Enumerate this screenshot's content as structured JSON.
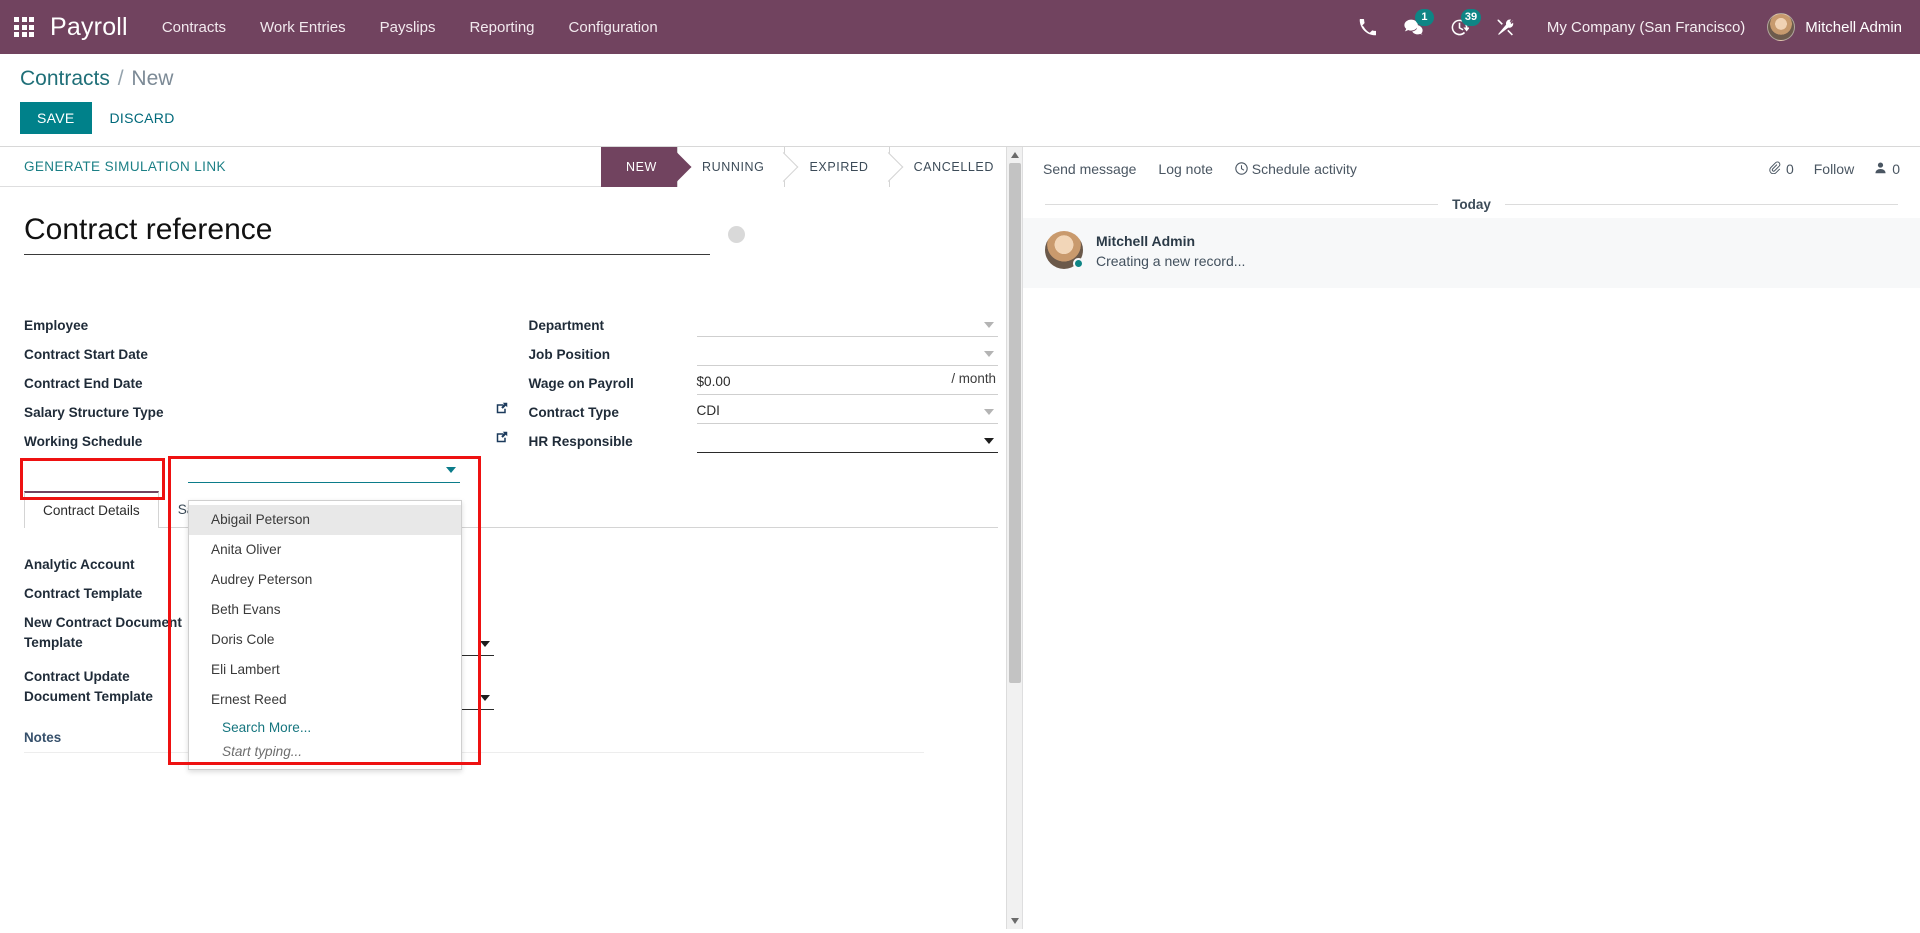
{
  "navbar": {
    "apps_icon": "apps-grid-icon",
    "brand": "Payroll",
    "menu": [
      {
        "label": "Contracts"
      },
      {
        "label": "Work Entries"
      },
      {
        "label": "Payslips"
      },
      {
        "label": "Reporting"
      },
      {
        "label": "Configuration"
      }
    ],
    "icons": [
      {
        "name": "phone-icon",
        "badge": null
      },
      {
        "name": "messages-icon",
        "badge": "1"
      },
      {
        "name": "activities-clock-icon",
        "badge": "39"
      },
      {
        "name": "debug-tools-icon",
        "badge": null
      }
    ],
    "company": "My Company (San Francisco)",
    "user": "Mitchell Admin",
    "accent_bg": "#71435f",
    "badge_color": "#0e8585"
  },
  "control_panel": {
    "breadcrumb_root": "Contracts",
    "breadcrumb_sep": "/",
    "breadcrumb_current": "New",
    "save_label": "SAVE",
    "discard_label": "DISCARD",
    "save_color": "#00818a"
  },
  "sheet_header": {
    "simulation_link": "GENERATE SIMULATION LINK",
    "statuses": [
      {
        "label": "NEW",
        "active": true
      },
      {
        "label": "RUNNING",
        "active": false
      },
      {
        "label": "EXPIRED",
        "active": false
      },
      {
        "label": "CANCELLED",
        "active": false
      }
    ]
  },
  "form": {
    "title_placeholder": "Contract reference",
    "title_value": "",
    "left_fields": [
      {
        "label": "Employee",
        "value": "",
        "widget": "many2one",
        "highlighted": true
      },
      {
        "label": "Contract Start Date",
        "value": "",
        "widget": "date"
      },
      {
        "label": "Contract End Date",
        "value": "",
        "widget": "date"
      },
      {
        "label": "Salary Structure Type",
        "value": "",
        "widget": "many2one-internal"
      },
      {
        "label": "Working Schedule",
        "value": "",
        "widget": "many2one-internal"
      }
    ],
    "right_fields": [
      {
        "label": "Department",
        "value": "",
        "widget": "many2one"
      },
      {
        "label": "Job Position",
        "value": "",
        "widget": "many2one"
      },
      {
        "label": "Wage on Payroll",
        "value": "$0.00",
        "widget": "monetary",
        "suffix": "/ month"
      },
      {
        "label": "Contract Type",
        "value": "CDI",
        "widget": "many2one-external"
      },
      {
        "label": "HR Responsible",
        "value": "",
        "widget": "many2one-focused"
      }
    ],
    "tabs": [
      {
        "label": "Contract Details",
        "active": true
      },
      {
        "label": "Salary Information",
        "active": false
      }
    ],
    "detail_fields": [
      {
        "label": "Analytic Account",
        "value": ""
      },
      {
        "label": "Contract Template",
        "value": ""
      },
      {
        "label": "New Contract Document Template",
        "value": "",
        "caret": true
      },
      {
        "label": "Contract Update Document Template",
        "value": "",
        "caret": true
      }
    ],
    "notes_label": "Notes"
  },
  "employee_dropdown": {
    "open": true,
    "input_value": "",
    "items": [
      {
        "label": "Abigail Peterson",
        "highlighted": true
      },
      {
        "label": "Anita Oliver",
        "highlighted": false
      },
      {
        "label": "Audrey Peterson",
        "highlighted": false
      },
      {
        "label": "Beth Evans",
        "highlighted": false
      },
      {
        "label": "Doris Cole",
        "highlighted": false
      },
      {
        "label": "Eli Lambert",
        "highlighted": false
      },
      {
        "label": "Ernest Reed",
        "highlighted": false
      }
    ],
    "search_more": "Search More...",
    "hint": "Start typing...",
    "link_color": "#16767f"
  },
  "chatter": {
    "send_message": "Send message",
    "log_note": "Log note",
    "schedule_activity": "Schedule activity",
    "attachment_count": "0",
    "follow_label": "Follow",
    "follower_count": "0",
    "day_separator": "Today",
    "messages": [
      {
        "author": "Mitchell Admin",
        "body": "Creating a new record..."
      }
    ]
  },
  "highlight_color": "#ee1111"
}
